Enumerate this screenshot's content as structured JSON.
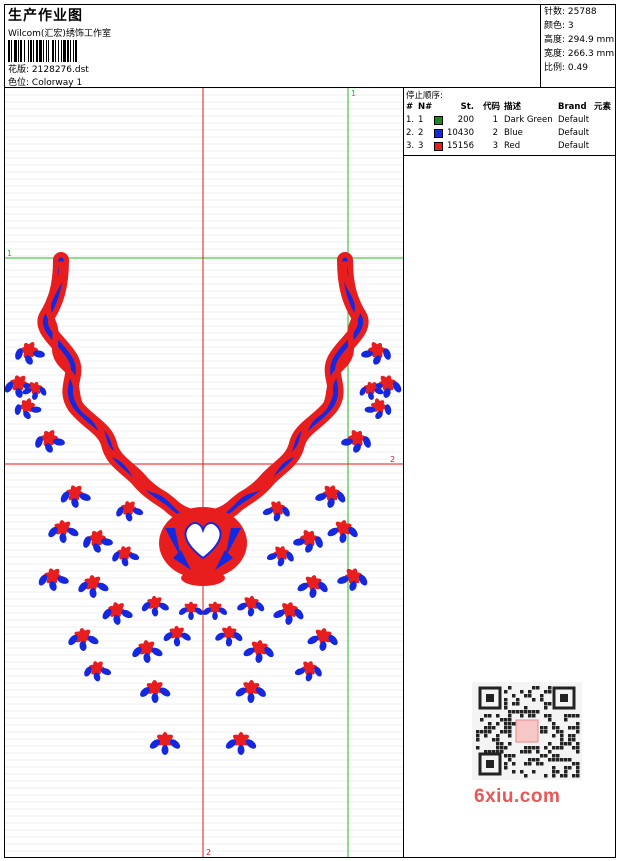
{
  "header": {
    "title": "生产作业图",
    "studio": "Wilcom(汇宏)绣饰工作室",
    "design_label": "花版:",
    "design_value": "2128276.dst",
    "colorway_label": "色位:",
    "colorway_value": "Colorway 1"
  },
  "stats": [
    {
      "label": "针数:",
      "value": "25788"
    },
    {
      "label": "颜色:",
      "value": "3"
    },
    {
      "label": "高度:",
      "value": "294.9 mm"
    },
    {
      "label": "宽度:",
      "value": "266.3 mm"
    },
    {
      "label": "比例:",
      "value": "0.49"
    }
  ],
  "stop_sequence": {
    "title": "停止顺序:",
    "columns": [
      "#",
      "N#",
      "St.",
      "代码",
      "描述",
      "Brand",
      "元素"
    ],
    "rows": [
      {
        "index": "1.",
        "n": "1",
        "stitches": "200",
        "code": "1",
        "description": "Dark Green",
        "brand": "Default",
        "color": "#1a8a1a"
      },
      {
        "index": "2.",
        "n": "2",
        "stitches": "10430",
        "code": "2",
        "description": "Blue",
        "brand": "Default",
        "color": "#1428e0"
      },
      {
        "index": "3.",
        "n": "3",
        "stitches": "15156",
        "code": "3",
        "description": "Red",
        "brand": "Default",
        "color": "#e81e1e"
      }
    ]
  },
  "guides": {
    "v_green_label": "1",
    "h_green_label": "1",
    "h_red_label": "2",
    "v_red_label": "2",
    "green": "#22bb22",
    "red": "#e01818"
  },
  "watermark": {
    "text": "6xiu.com"
  }
}
